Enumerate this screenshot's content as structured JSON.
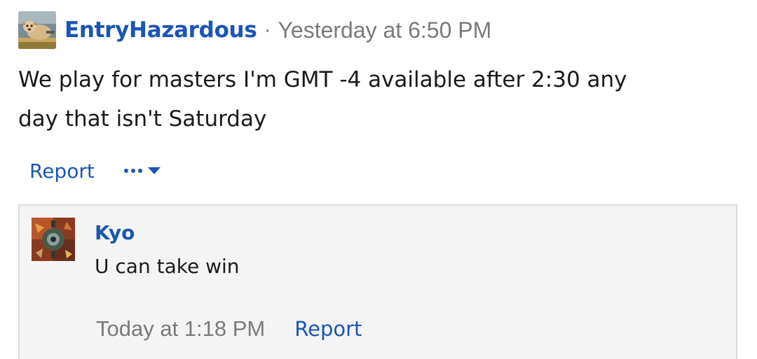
{
  "post": {
    "username": "EntryHazardous",
    "separator": "·",
    "timestamp": "Yesterday at 6:50 PM",
    "body_line1": "We play for masters I'm GMT -4 available after 2:30 any",
    "body_line2": "day that isn't Saturday",
    "report_label": "Report",
    "avatar_icon": "dog-photo-avatar",
    "more_icon": "more-options-icon"
  },
  "reply": {
    "username": "Kyo",
    "text": "U can take win",
    "timestamp": "Today at 1:18 PM",
    "report_label": "Report",
    "avatar_icon": "abstract-art-avatar"
  },
  "colors": {
    "link": "#1a56b3",
    "muted": "#7a7a7a",
    "text": "#1a1a1a",
    "reply_bg": "#f4f4f4",
    "reply_border": "#dcdcdc"
  }
}
